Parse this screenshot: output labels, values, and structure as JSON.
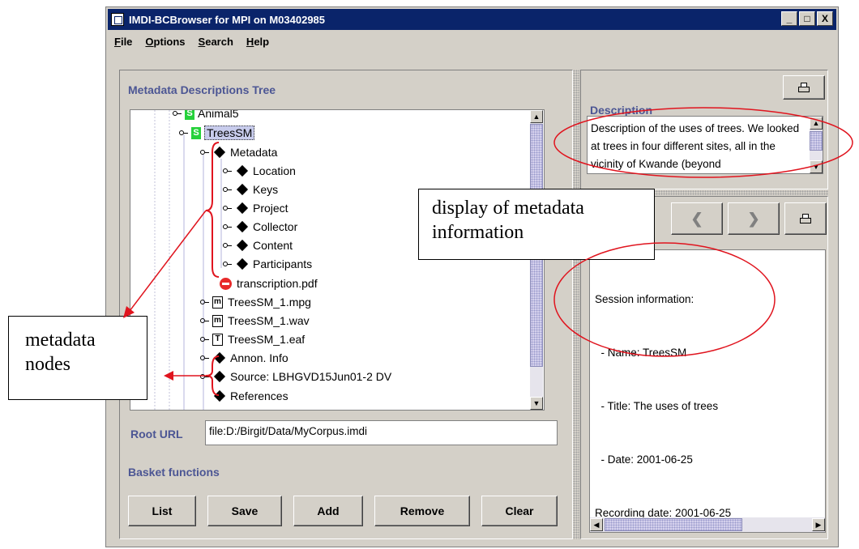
{
  "window": {
    "title": "IMDI-BCBrowser for MPI on M03402985",
    "controls": [
      "_",
      "□",
      "X"
    ]
  },
  "menu": [
    "File",
    "Options",
    "Search",
    "Help"
  ],
  "tree_panel": {
    "title": "Metadata Descriptions Tree",
    "nodes": [
      {
        "label": "Animal5",
        "icon": "session-icon"
      },
      {
        "label": "TreesSM",
        "icon": "session-icon",
        "selected": true
      },
      {
        "label": "Metadata",
        "icon": "diamond-icon"
      },
      {
        "label": "Location",
        "icon": "diamond-icon"
      },
      {
        "label": "Keys",
        "icon": "diamond-icon"
      },
      {
        "label": "Project",
        "icon": "diamond-icon"
      },
      {
        "label": "Collector",
        "icon": "diamond-icon"
      },
      {
        "label": "Content",
        "icon": "diamond-icon"
      },
      {
        "label": "Participants",
        "icon": "diamond-icon"
      },
      {
        "label": "transcription.pdf",
        "icon": "no-entry-icon"
      },
      {
        "label": "TreesSM_1.mpg",
        "icon": "media-icon",
        "badge": "m"
      },
      {
        "label": "TreesSM_1.wav",
        "icon": "media-icon",
        "badge": "m"
      },
      {
        "label": "TreesSM_1.eaf",
        "icon": "text-icon",
        "badge": "T"
      },
      {
        "label": "Annon. Info",
        "icon": "diamond-icon"
      },
      {
        "label": "Source: LBHGVD15Jun01-2 DV",
        "icon": "diamond-icon"
      },
      {
        "label": "References",
        "icon": "diamond-icon"
      }
    ],
    "session_badge": "S",
    "root_url_label": "Root URL",
    "root_url_value": "file:D:/Birgit/Data/MyCorpus.imdi",
    "basket_title": "Basket functions",
    "buttons": [
      "List",
      "Save",
      "Add",
      "Remove",
      "Clear"
    ]
  },
  "description_panel": {
    "title": "Description",
    "text": "Description of the uses of trees.  We looked at trees in four different sites, all in the vicinity of Kwande (beyond"
  },
  "info_panel": {
    "lines": [
      "Session information:",
      "  - Name: TreesSM",
      "  - Title: The uses of trees",
      "  - Date: 2001-06-25",
      "Recording date: 2001-06-25"
    ]
  },
  "annotations": {
    "display_label": "display of metadata information",
    "nodes_label": "metadata nodes",
    "accent_color": "#e0141e"
  },
  "colors": {
    "titlebar": "#0a246a",
    "panel_title": "#4c5694",
    "face": "#d4d0c8"
  }
}
